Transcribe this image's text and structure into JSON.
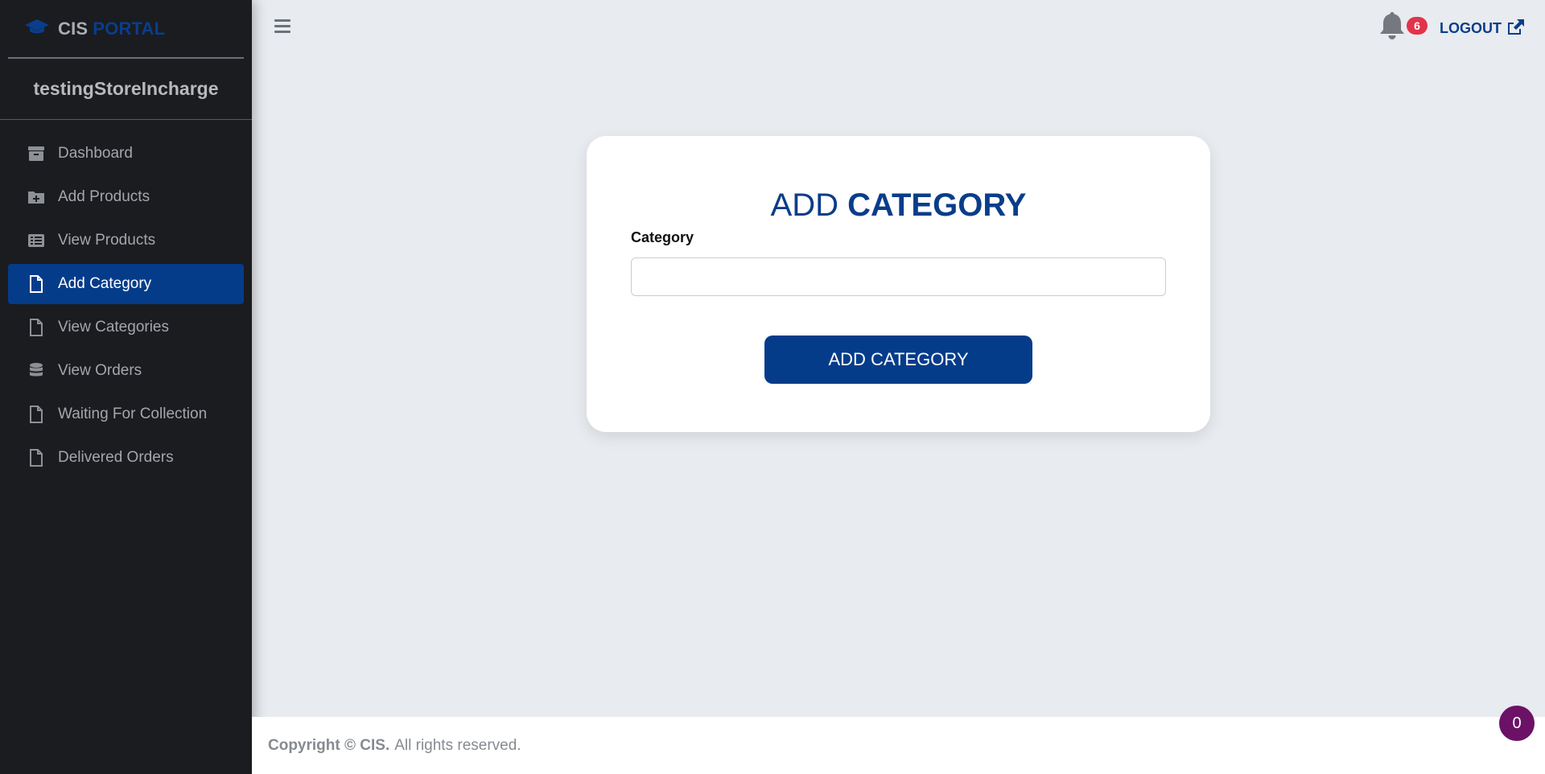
{
  "brand": {
    "name": "CIS",
    "accent": "PORTAL",
    "icon": "graduation-cap-icon"
  },
  "user": {
    "name": "testingStoreIncharge"
  },
  "sidebar": {
    "items": [
      {
        "label": "Dashboard",
        "icon": "archive-icon",
        "active": false
      },
      {
        "label": "Add Products",
        "icon": "folder-plus-icon",
        "active": false
      },
      {
        "label": "View Products",
        "icon": "list-icon",
        "active": false
      },
      {
        "label": "Add Category",
        "icon": "file-icon",
        "active": true
      },
      {
        "label": "View Categories",
        "icon": "file-icon",
        "active": false
      },
      {
        "label": "View Orders",
        "icon": "database-icon",
        "active": false
      },
      {
        "label": "Waiting For Collection",
        "icon": "file-icon",
        "active": false
      },
      {
        "label": "Delivered Orders",
        "icon": "file-icon",
        "active": false
      }
    ]
  },
  "header": {
    "notifications_count": "6",
    "logout_label": "LOGOUT"
  },
  "form": {
    "title_light": "ADD",
    "title_bold": "CATEGORY",
    "field_label": "Category",
    "field_value": "",
    "field_placeholder": "",
    "submit_label": "ADD CATEGORY"
  },
  "footer": {
    "copyright_strong": "Copyright © CIS.",
    "copyright_rest": "All rights reserved."
  },
  "floating_badge": {
    "value": "0"
  },
  "colors": {
    "primary": "#053c8a",
    "sidebar_bg": "#1a1c20",
    "page_bg": "#e8ebef",
    "badge_red": "#e1344a",
    "fab_purple": "#6b1266"
  }
}
